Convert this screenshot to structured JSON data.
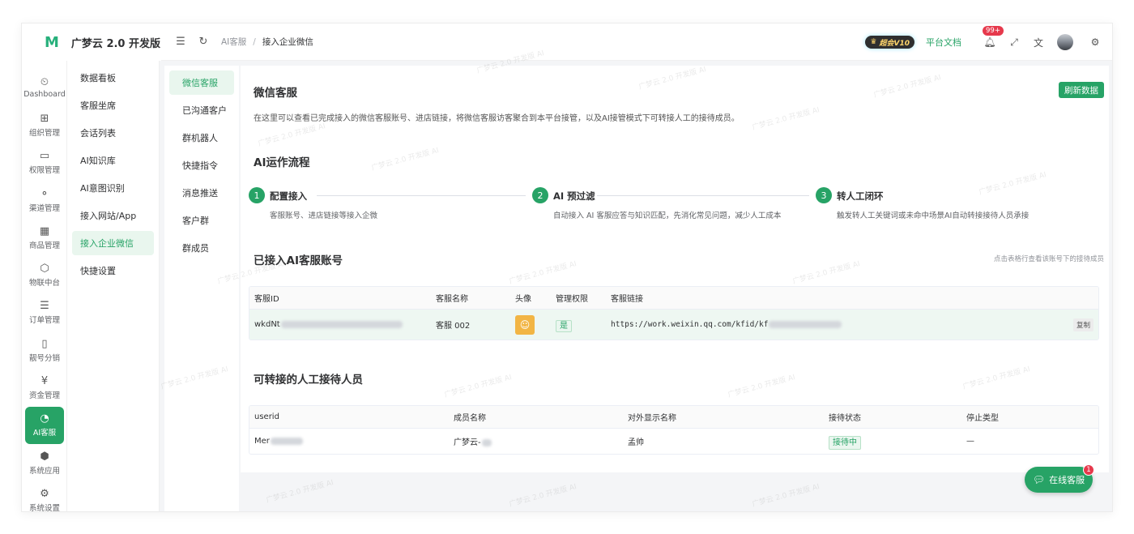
{
  "app": {
    "logo_mark": "M",
    "logo_text": "广梦云 2.0 开发版"
  },
  "rail": [
    {
      "icon": "⏲",
      "label": "Dashboard"
    },
    {
      "icon": "⊞",
      "label": "组织管理"
    },
    {
      "icon": "▭",
      "label": "权限管理"
    },
    {
      "icon": "⚬",
      "label": "渠道管理"
    },
    {
      "icon": "▦",
      "label": "商品管理"
    },
    {
      "icon": "⬡",
      "label": "物联中台"
    },
    {
      "icon": "☰",
      "label": "订单管理"
    },
    {
      "icon": "▯",
      "label": "靓号分销"
    },
    {
      "icon": "¥",
      "label": "资金管理"
    },
    {
      "icon": "◔",
      "label": "AI客服"
    },
    {
      "icon": "⬢",
      "label": "系统应用"
    },
    {
      "icon": "⚙",
      "label": "系统设置"
    }
  ],
  "menu2": [
    "数据看板",
    "客服坐席",
    "会话列表",
    "AI知识库",
    "AI意图识别",
    "接入网站/App",
    "接入企业微信",
    "快捷设置"
  ],
  "topbar": {
    "crumb_root": "AI客服",
    "crumb_sep": "/",
    "crumb_current": "接入企业微信",
    "vip": "超会V10",
    "docs": "平台文档",
    "bell_count": "99+"
  },
  "tabs": [
    "微信客服",
    "已沟通客户",
    "群机器人",
    "快捷指令",
    "消息推送",
    "客户群",
    "群成员"
  ],
  "main": {
    "title": "微信客服",
    "refresh": "刷新数据",
    "desc": "在这里可以查看已完成接入的微信客服账号、进店链接，将微信客服访客聚合到本平台接管，以及AI接管模式下可转接人工的接待成员。",
    "flow_title": "AI运作流程",
    "steps": [
      {
        "num": "1",
        "title": "配置接入",
        "desc": "客服账号、进店链接等接入企微"
      },
      {
        "num": "2",
        "title": "AI 预过滤",
        "desc": "自动接入 AI 客服应答与知识匹配，先消化常见问题，减少人工成本"
      },
      {
        "num": "3",
        "title": "转人工闭环",
        "desc": "触发转人工关键词或未命中场景AI自动转接接待人员承接"
      }
    ],
    "accounts_title": "已接入AI客服账号",
    "accounts_hint": "点击表格行查看该账号下的接待成员",
    "accounts_cols": [
      "客服ID",
      "客服名称",
      "头像",
      "管理权限",
      "客服链接"
    ],
    "accounts_row": {
      "id_prefix": "wkdNt",
      "name": "客服 002",
      "admin": "是",
      "link_prefix": "https://work.weixin.qq.com/kfid/kf",
      "copy": "复制"
    },
    "staff_title": "可转接的人工接待人员",
    "staff_cols": [
      "userid",
      "成员名称",
      "对外显示名称",
      "接待状态",
      "停止类型"
    ],
    "staff_row": {
      "userid_prefix": "Mer",
      "member_prefix": "广梦云-",
      "display": "孟帅",
      "status": "接待中",
      "stop": "—"
    }
  },
  "fab": {
    "label": "在线客服",
    "badge": "1"
  },
  "watermark": "广梦云 2.0 开发版 AI"
}
